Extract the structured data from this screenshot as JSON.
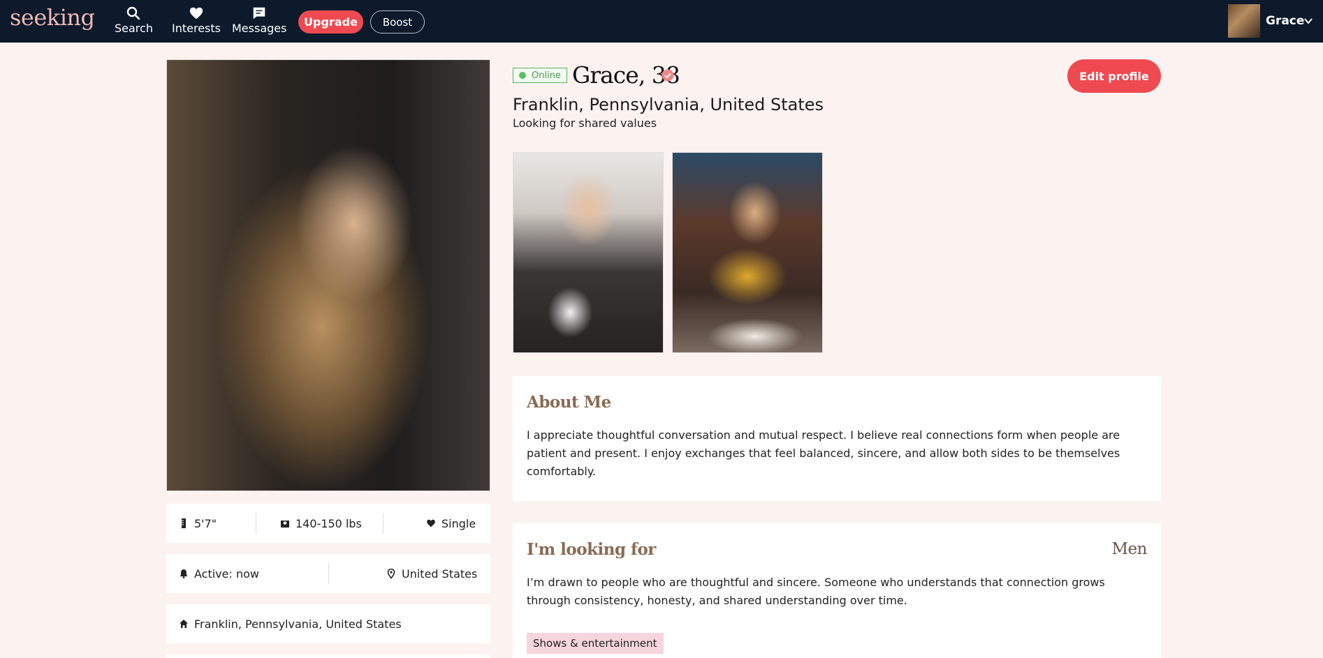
{
  "app": {
    "logo": "seeking"
  },
  "nav": {
    "search": "Search",
    "interests": "Interests",
    "messages": "Messages",
    "upgrade": "Upgrade",
    "boost": "Boost",
    "user_name": "Grace"
  },
  "profile": {
    "status": "Online",
    "name_age": "Grace, 38",
    "location": "Franklin, Pennsylvania, United States",
    "looking_for": "Looking for shared values",
    "edit_button": "Edit profile"
  },
  "stats": {
    "height": "5'7\"",
    "weight": "140-150 lbs",
    "relationship": "Single",
    "active": "Active: now",
    "country": "United States",
    "home": "Franklin, Pennsylvania, United States"
  },
  "about": {
    "heading": "About Me",
    "text": "I appreciate thoughtful conversation and mutual respect. I believe real connections form when people are patient and present. I enjoy exchanges that feel balanced, sincere, and allow both sides to be themselves comfortably."
  },
  "seeking": {
    "heading": "I'm looking for",
    "gender": "Men",
    "text": "I’m drawn to people who are thoughtful and sincere. Someone who understands that connection grows through consistency, honesty, and shared understanding over time.",
    "tags": [
      "Shows & entertainment"
    ]
  },
  "colors": {
    "nav_bg": "#0c1a2b",
    "page_bg": "#fcf3f1",
    "accent": "#ef4a52",
    "online": "#5bae62",
    "heading": "#8a6a53",
    "tag_bg": "#f6d6dc"
  },
  "icons": {
    "search": "search-icon",
    "interests": "heart-icon",
    "messages": "message-icon",
    "verified": "verified-check-icon",
    "height": "ruler-icon",
    "weight": "scale-icon",
    "relationship": "heart-icon",
    "active": "bell-icon",
    "country": "location-pin-icon",
    "home": "home-icon",
    "caret": "chevron-down-icon"
  }
}
